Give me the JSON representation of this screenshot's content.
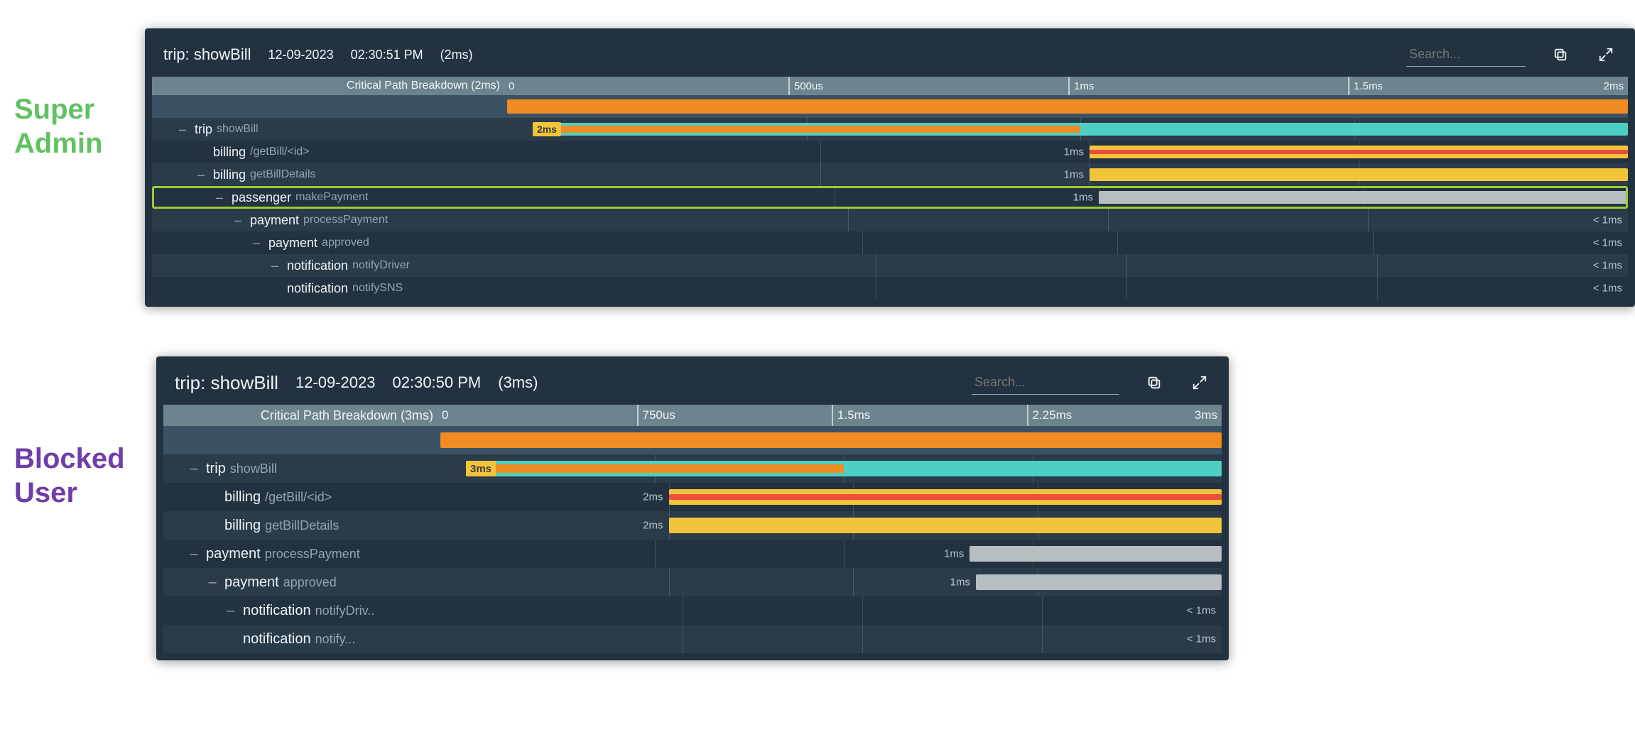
{
  "labels": {
    "super_admin": "Super Admin",
    "blocked_user": "Blocked User"
  },
  "icons": {
    "copy": "copy-icon",
    "expand": "expand-icon"
  },
  "panel1": {
    "title_prefix": "trip:",
    "title_suffix": "showBill",
    "date": "12-09-2023",
    "time": "02:30:51 PM",
    "duration": "(2ms)",
    "search_placeholder": "Search...",
    "axis_label": "Critical Path Breakdown (2ms)",
    "ticks": [
      "0",
      "500us",
      "1ms",
      "1.5ms",
      "2ms"
    ],
    "total_us": 2000,
    "spans": [
      {
        "svc": "trip",
        "op": "showBill",
        "indent": 1,
        "toggle": true,
        "start": 0,
        "end": 2000,
        "duration_label": "2ms",
        "style": "teal+orange"
      },
      {
        "svc": "billing",
        "op": "/getBill/<id>",
        "indent": 2,
        "toggle": false,
        "start": 1000,
        "end": 2000,
        "duration_label": "1ms",
        "style": "yellow+red"
      },
      {
        "svc": "billing",
        "op": "getBillDetails",
        "indent": 2,
        "toggle": true,
        "start": 1000,
        "end": 2000,
        "duration_label": "1ms",
        "style": "yellow-full"
      },
      {
        "svc": "passenger",
        "op": "makePayment",
        "indent": 3,
        "toggle": true,
        "start": 1000,
        "end": 2000,
        "duration_label": "1ms",
        "style": "grey",
        "highlight": true
      },
      {
        "svc": "payment",
        "op": "processPayment",
        "indent": 4,
        "toggle": true,
        "start": 2000,
        "end": 2000,
        "duration_label": "< 1ms",
        "style": "none"
      },
      {
        "svc": "payment",
        "op": "approved",
        "indent": 5,
        "toggle": true,
        "start": 2000,
        "end": 2000,
        "duration_label": "< 1ms",
        "style": "none"
      },
      {
        "svc": "notification",
        "op": "notifyDriver",
        "indent": 6,
        "toggle": true,
        "start": 2000,
        "end": 2000,
        "duration_label": "< 1ms",
        "style": "none"
      },
      {
        "svc": "notification",
        "op": "notifySNS",
        "indent": 6,
        "toggle": false,
        "start": 2000,
        "end": 2000,
        "duration_label": "< 1ms",
        "style": "none"
      }
    ]
  },
  "panel2": {
    "title_prefix": "trip:",
    "title_suffix": "showBill",
    "date": "12-09-2023",
    "time": "02:30:50 PM",
    "duration": "(3ms)",
    "search_placeholder": "Search...",
    "axis_label": "Critical Path Breakdown (3ms)",
    "ticks": [
      "0",
      "750us",
      "1.5ms",
      "2.25ms",
      "3ms"
    ],
    "total_us": 3000,
    "spans": [
      {
        "svc": "trip",
        "op": "showBill",
        "indent": 1,
        "toggle": true,
        "start": 0,
        "end": 3000,
        "duration_label": "3ms",
        "style": "teal+orange"
      },
      {
        "svc": "billing",
        "op": "/getBill/<id>",
        "indent": 2,
        "toggle": false,
        "start": 750,
        "end": 3000,
        "duration_label": "2ms",
        "style": "yellow+red"
      },
      {
        "svc": "billing",
        "op": "getBillDetails",
        "indent": 2,
        "toggle": false,
        "start": 750,
        "end": 3000,
        "duration_label": "2ms",
        "style": "yellow-full"
      },
      {
        "svc": "payment",
        "op": "processPayment",
        "indent": 1,
        "toggle": true,
        "start": 2000,
        "end": 3000,
        "duration_label": "1ms",
        "style": "grey"
      },
      {
        "svc": "payment",
        "op": "approved",
        "indent": 2,
        "toggle": true,
        "start": 2000,
        "end": 3000,
        "duration_label": "1ms",
        "style": "grey"
      },
      {
        "svc": "notification",
        "op": "notifyDriv..",
        "indent": 3,
        "toggle": true,
        "start": 3000,
        "end": 3000,
        "duration_label": "< 1ms",
        "style": "none"
      },
      {
        "svc": "notification",
        "op": "notify...",
        "indent": 3,
        "toggle": false,
        "start": 3000,
        "end": 3000,
        "duration_label": "< 1ms",
        "style": "none"
      }
    ]
  },
  "chart_data": [
    {
      "type": "gantt",
      "title": "Critical Path Breakdown (2ms)",
      "x_unit": "us",
      "xlim": [
        0,
        2000
      ],
      "ticks": [
        0,
        500,
        1000,
        1500,
        2000
      ],
      "rows": [
        {
          "name": "trip showBill",
          "start": 0,
          "end": 2000,
          "duration": "2ms"
        },
        {
          "name": "billing /getBill/<id>",
          "start": 1000,
          "end": 2000,
          "duration": "1ms"
        },
        {
          "name": "billing getBillDetails",
          "start": 1000,
          "end": 2000,
          "duration": "1ms"
        },
        {
          "name": "passenger makePayment",
          "start": 1000,
          "end": 2000,
          "duration": "1ms",
          "highlighted": true
        },
        {
          "name": "payment processPayment",
          "start": 2000,
          "end": 2000,
          "duration": "< 1ms"
        },
        {
          "name": "payment approved",
          "start": 2000,
          "end": 2000,
          "duration": "< 1ms"
        },
        {
          "name": "notification notifyDriver",
          "start": 2000,
          "end": 2000,
          "duration": "< 1ms"
        },
        {
          "name": "notification notifySNS",
          "start": 2000,
          "end": 2000,
          "duration": "< 1ms"
        }
      ]
    },
    {
      "type": "gantt",
      "title": "Critical Path Breakdown (3ms)",
      "x_unit": "us",
      "xlim": [
        0,
        3000
      ],
      "ticks": [
        0,
        750,
        1500,
        2250,
        3000
      ],
      "rows": [
        {
          "name": "trip showBill",
          "start": 0,
          "end": 3000,
          "duration": "3ms"
        },
        {
          "name": "billing /getBill/<id>",
          "start": 750,
          "end": 3000,
          "duration": "2ms"
        },
        {
          "name": "billing getBillDetails",
          "start": 750,
          "end": 3000,
          "duration": "2ms"
        },
        {
          "name": "payment processPayment",
          "start": 2000,
          "end": 3000,
          "duration": "1ms"
        },
        {
          "name": "payment approved",
          "start": 2000,
          "end": 3000,
          "duration": "1ms"
        },
        {
          "name": "notification notifyDriver",
          "start": 3000,
          "end": 3000,
          "duration": "< 1ms"
        },
        {
          "name": "notification notifySNS",
          "start": 3000,
          "end": 3000,
          "duration": "< 1ms"
        }
      ]
    }
  ]
}
